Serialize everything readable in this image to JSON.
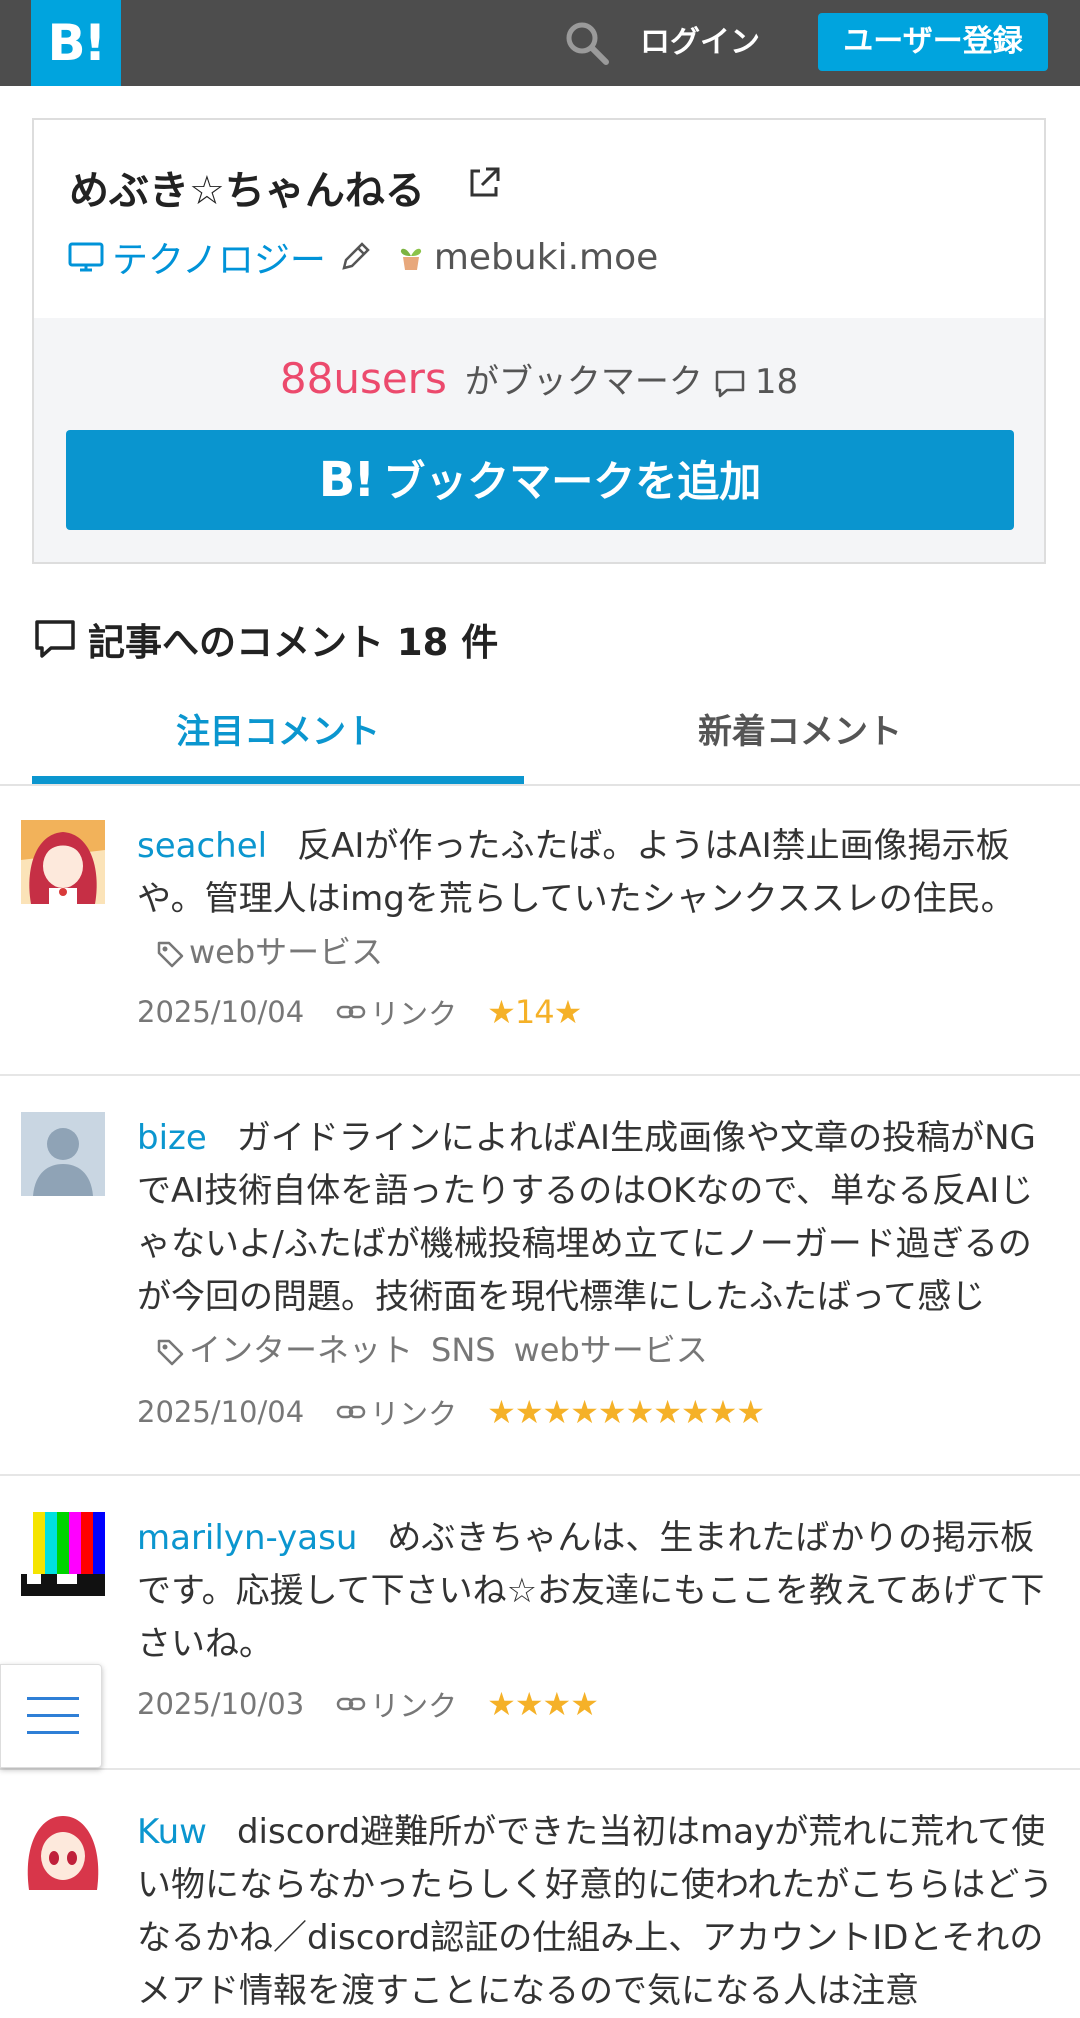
{
  "header": {
    "logo_text": "B!",
    "search_icon": "search-icon",
    "login_label": "ログイン",
    "register_label": "ユーザー登録"
  },
  "entry": {
    "title": "めぶき☆ちゃんねる",
    "category": "テクノロジー",
    "domain": "mebuki.moe",
    "users_count": "88users",
    "bookmarked_text": "がブックマーク",
    "comment_count": "18",
    "add_button_logo": "B!",
    "add_button_label": "ブックマークを追加"
  },
  "comments_section": {
    "heading": "記事へのコメント 18 件",
    "tabs": [
      {
        "label": "注目コメント",
        "active": true
      },
      {
        "label": "新着コメント",
        "active": false
      }
    ]
  },
  "comments": [
    {
      "user": "seachel",
      "text": "反AIが作ったふたば。ようはAI禁止画像掲示板や。管理人はimgを荒らしていたシャンクススレの住民。",
      "tags": [
        "webサービス"
      ],
      "date": "2025/10/04",
      "link": "リンク",
      "stars": "★14★"
    },
    {
      "user": "bize",
      "text": "ガイドラインによればAI生成画像や文章の投稿がNGでAI技術自体を語ったりするのはOKなので、単なる反AIじゃないよ/ふたばが機械投稿埋め立てにノーガード過ぎるのが今回の問題。技術面を現代標準にしたふたばって感じ",
      "tags": [
        "インターネット",
        "SNS",
        "webサービス"
      ],
      "date": "2025/10/04",
      "link": "リンク",
      "stars": "★★★★★★★★★★"
    },
    {
      "user": "marilyn-yasu",
      "text": "めぶきちゃんは、生まれたばかりの掲示板です。応援して下さいね☆お友達にもここを教えてあげて下さいね。",
      "tags": [],
      "date": "2025/10/03",
      "link": "リンク",
      "stars": "★★★★"
    },
    {
      "user": "Kuw",
      "text": "discord避難所ができた当初はmayが荒れに荒れて使い物にならなかったらしく好意的に使われたがこちらはどうなるかね／discord認証の仕組み上、アカウントIDとそれのメアド情報を渡すことになるので気になる人は注意",
      "tags": [],
      "date": "",
      "link": "",
      "stars": ""
    }
  ],
  "colors": {
    "header_bg": "#4d4d4d",
    "brand_blue": "#00a4de",
    "users_pink": "#ec4a6d",
    "star_yellow": "#f5b128"
  },
  "floating_menu_icon": "hamburger-menu-icon"
}
